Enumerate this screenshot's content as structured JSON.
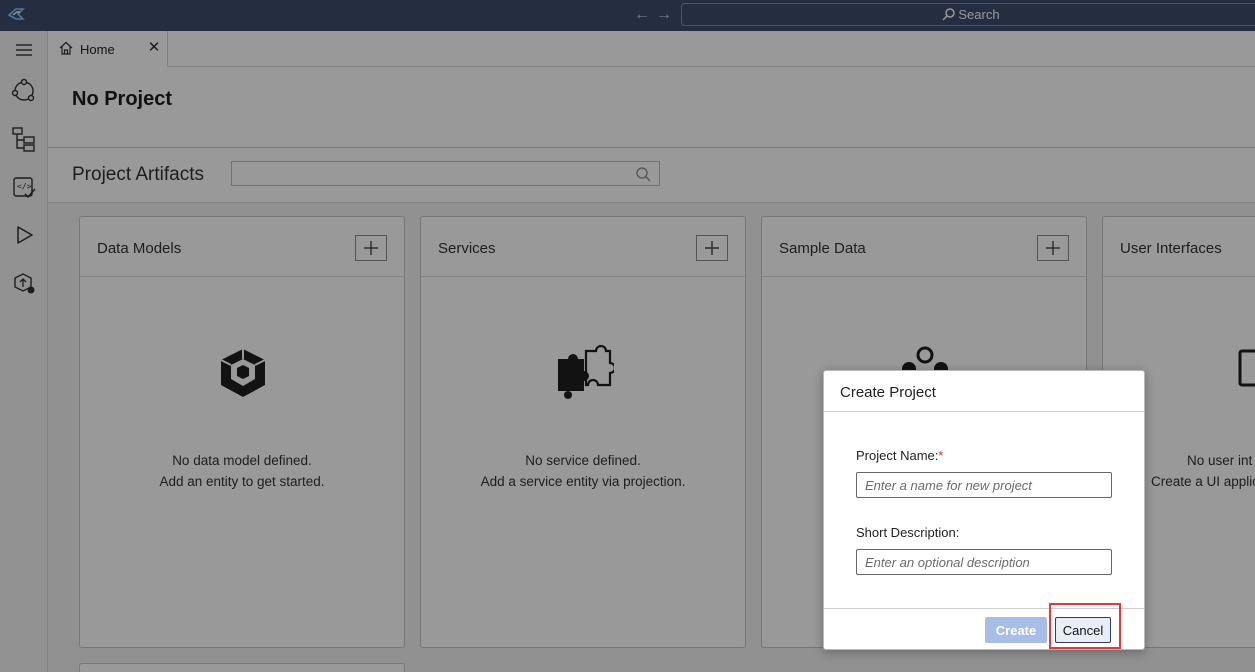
{
  "titlebar": {
    "search_label": "Search",
    "logo_icon": "app-logo-icon",
    "back_icon": "arrow-left-icon",
    "forward_icon": "arrow-right-icon"
  },
  "activity_bar": {
    "items": [
      {
        "icon": "menu-icon"
      },
      {
        "icon": "flow-icon"
      },
      {
        "icon": "hierarchy-icon"
      },
      {
        "icon": "code-check-icon"
      },
      {
        "icon": "play-icon"
      },
      {
        "icon": "deploy-icon"
      }
    ]
  },
  "tabs": [
    {
      "label": "Home",
      "icon": "home-icon"
    }
  ],
  "page": {
    "title": "No Project",
    "artifacts_title": "Project Artifacts"
  },
  "cards": [
    {
      "title": "Data Models",
      "icon": "data-model-icon",
      "empty_line1": "No data model defined.",
      "empty_line2": "Add an entity to get started."
    },
    {
      "title": "Services",
      "icon": "puzzle-icon",
      "empty_line1": "No service defined.",
      "empty_line2": "Add a service entity via projection."
    },
    {
      "title": "Sample Data",
      "icon": "sample-data-icon",
      "empty_line1": "",
      "empty_line2": ""
    },
    {
      "title": "User Interfaces",
      "icon": "monitor-icon",
      "empty_line1": "No user int",
      "empty_line2": "Create a UI applic"
    }
  ],
  "dialog": {
    "title": "Create Project",
    "name_label": "Project Name:",
    "name_required": "*",
    "name_placeholder": "Enter a name for new project",
    "desc_label": "Short Description:",
    "desc_placeholder": "Enter an optional description",
    "create_label": "Create",
    "cancel_label": "Cancel"
  },
  "colors": {
    "titlebar": "#3d4e6c",
    "primary_button_disabled": "#a9bde9",
    "highlight": "#e53935"
  }
}
